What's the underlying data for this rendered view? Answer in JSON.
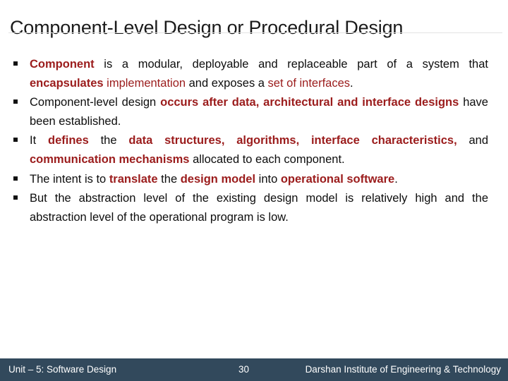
{
  "slide": {
    "title": "Component-Level Design or Procedural Design",
    "bullet_marker": "square-bullet",
    "colors": {
      "accent_red": "#9B1C1C",
      "text_black": "#0D0D0D",
      "footer_bar": "#32495C",
      "title_rule": "#E3E3E3"
    }
  },
  "bullets": [
    {
      "id": "bullet-1",
      "runs": [
        {
          "text": "Component",
          "style": "bold-red"
        },
        {
          "text": " is a modular, deployable and replaceable part of a system that ",
          "style": "black"
        },
        {
          "text": "encapsulates",
          "style": "bold-red"
        },
        {
          "text": " ",
          "style": "black"
        },
        {
          "text": "implementation",
          "style": "red"
        },
        {
          "text": " and exposes a ",
          "style": "black"
        },
        {
          "text": "set of interfaces",
          "style": "red"
        },
        {
          "text": ".",
          "style": "black"
        }
      ]
    },
    {
      "id": "bullet-2",
      "runs": [
        {
          "text": "Component-level design ",
          "style": "black"
        },
        {
          "text": "occurs after data, architectural and interface designs",
          "style": "bold-red"
        },
        {
          "text": " have been established.",
          "style": "black"
        }
      ]
    },
    {
      "id": "bullet-3",
      "runs": [
        {
          "text": "It ",
          "style": "black"
        },
        {
          "text": "defines",
          "style": "bold-red"
        },
        {
          "text": " the ",
          "style": "black"
        },
        {
          "text": "data structures, algorithms, interface characteristics,",
          "style": "bold-red"
        },
        {
          "text": " and ",
          "style": "black"
        },
        {
          "text": "communication mechanisms",
          "style": "bold-red"
        },
        {
          "text": " allocated to each component.",
          "style": "black"
        }
      ]
    },
    {
      "id": "bullet-4",
      "runs": [
        {
          "text": "The intent is to ",
          "style": "black"
        },
        {
          "text": "translate",
          "style": "bold-red"
        },
        {
          "text": " the ",
          "style": "black"
        },
        {
          "text": "design model",
          "style": "bold-red"
        },
        {
          "text": " into ",
          "style": "black"
        },
        {
          "text": "operational software",
          "style": "bold-red"
        },
        {
          "text": ".",
          "style": "black"
        }
      ]
    },
    {
      "id": "bullet-5",
      "runs": [
        {
          "text": "But the abstraction level of the existing design model is relatively high and the abstraction level of the operational program is low.",
          "style": "black"
        }
      ]
    }
  ],
  "footer": {
    "left": "Unit – 5: Software Design",
    "page_number": "30",
    "right": "Darshan Institute of Engineering & Technology"
  }
}
